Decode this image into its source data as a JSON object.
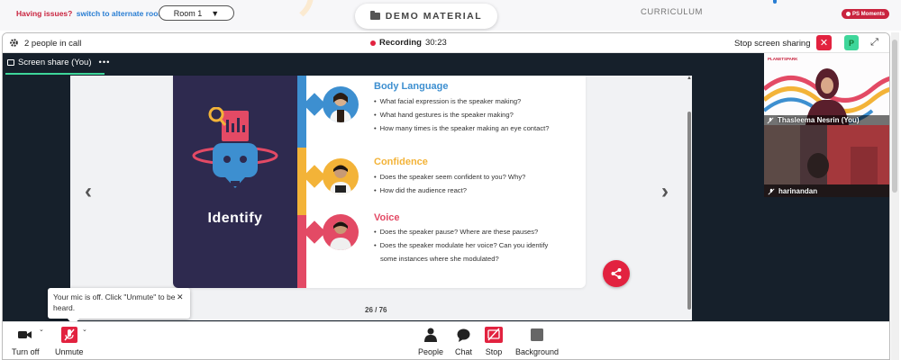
{
  "topbar": {
    "issues_q": "Having issues?",
    "issues_link": "switch to alternate room",
    "room_label": "Room 1",
    "room_caret": "▼",
    "demo_material": "DEMO MATERIAL",
    "curriculum": "CURRICULUM",
    "ps_moments": "PS Moments"
  },
  "callbar": {
    "people_count": "2 people in call",
    "recording_label": "Recording",
    "recording_time": "30:23",
    "stop_screen_sharing": "Stop screen sharing",
    "close_glyph": "✕",
    "p_badge": "P",
    "expand_glyph": "⤢"
  },
  "stage": {
    "share_tab_label": "Screen share (You)",
    "share_tab_more": "•••",
    "prev_glyph": "‹",
    "next_glyph": "›",
    "page_indicator": "26 / 76"
  },
  "slide": {
    "identify": "Identify",
    "sections": [
      {
        "title": "Body Language",
        "bullets": [
          "What facial expression is the speaker making?",
          "What hand gestures is the speaker making?",
          "How many times is the speaker making an eye contact?"
        ]
      },
      {
        "title": "Confidence",
        "bullets": [
          "Does the speaker seem confident to you? Why?",
          "How did the audience react?"
        ]
      },
      {
        "title": "Voice",
        "bullets": [
          "Does the speaker pause? Where are these pauses?",
          "Does the speaker modulate her voice? Can you identify",
          "some instances where she modulated?"
        ]
      }
    ],
    "colors": {
      "blue": "#3d8fd0",
      "yellow": "#f3b338",
      "red": "#e34a65",
      "navy": "#2e2a4f"
    }
  },
  "tooltip": {
    "text": "Your mic is off. Click \"Unmute\" to be heard.",
    "close_glyph": "✕"
  },
  "participants": [
    {
      "name": "Thasleema Nesrin (You)",
      "brand": "PLANETSPARK"
    },
    {
      "name": "harinandan"
    }
  ],
  "controls": {
    "turn_off": "Turn off",
    "unmute": "Unmute",
    "people": "People",
    "chat": "Chat",
    "stop": "Stop",
    "background": "Background"
  },
  "accent": {
    "red": "#e2223f",
    "green": "#3ed69a",
    "dark": "#16202b"
  }
}
